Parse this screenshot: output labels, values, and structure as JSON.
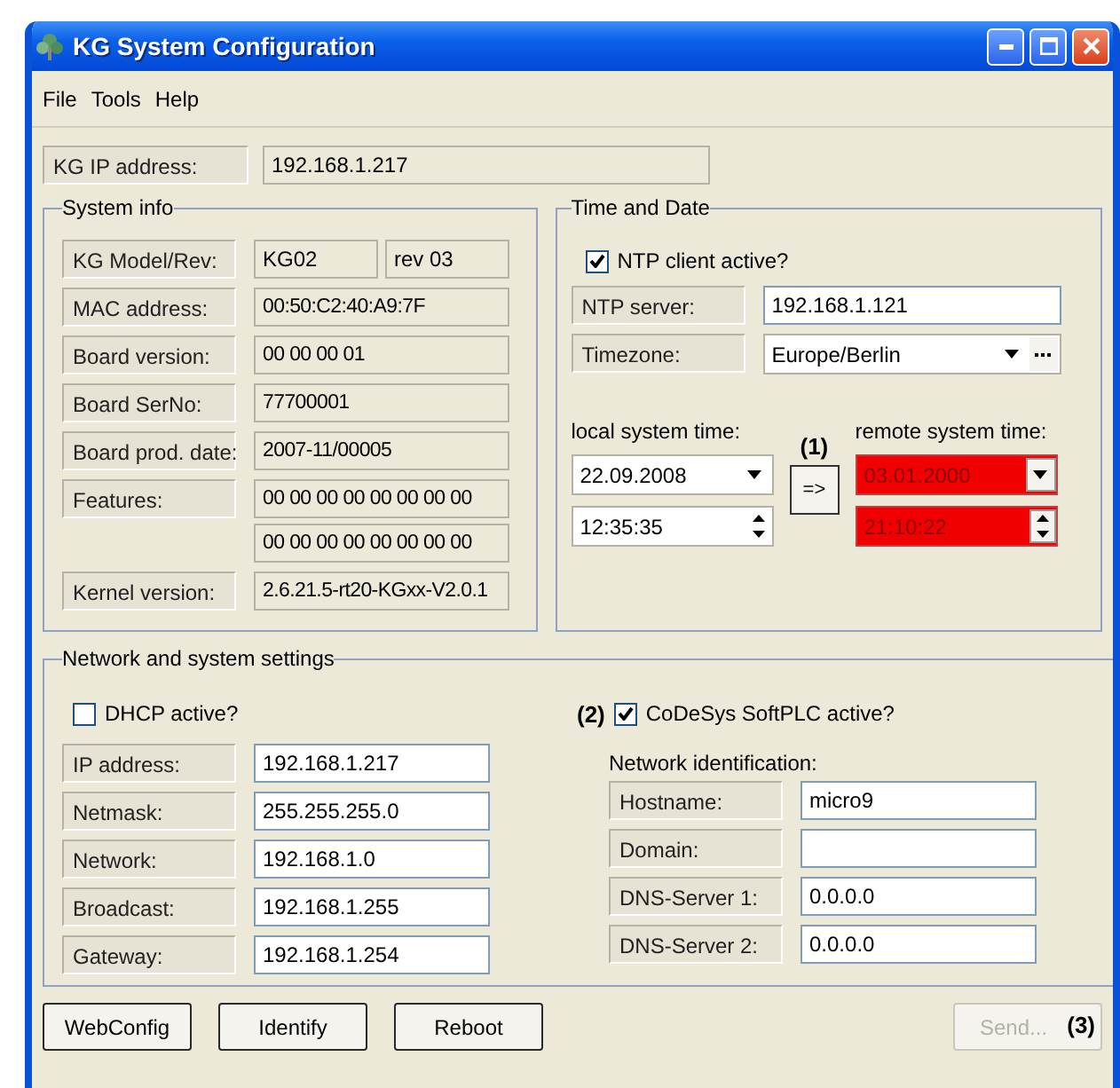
{
  "window": {
    "title": "KG System Configuration"
  },
  "menu": [
    "File",
    "Tools",
    "Help"
  ],
  "kg_ip": {
    "label": "KG IP address:",
    "value": "192.168.1.217"
  },
  "system_info": {
    "title": "System info",
    "rows": [
      {
        "kind": "pair",
        "label": "KG Model/Rev:",
        "values": [
          "KG02",
          "rev 03"
        ]
      },
      {
        "kind": "single",
        "label": "MAC address:",
        "values": [
          "00:50:C2:40:A9:7F"
        ]
      },
      {
        "kind": "single",
        "label": "Board version:",
        "values": [
          "00 00 00 01"
        ]
      },
      {
        "kind": "single",
        "label": "Board SerNo:",
        "values": [
          "77700001"
        ]
      },
      {
        "kind": "single",
        "label": "Board prod. date:",
        "values": [
          "2007-11/00005"
        ]
      },
      {
        "kind": "stack",
        "label": "Features:",
        "values": [
          "00 00 00 00 00 00 00 00",
          "00 00 00 00 00 00 00 00"
        ]
      },
      {
        "kind": "single",
        "label": "Kernel version:",
        "values": [
          "2.6.21.5-rt20-KGxx-V2.0.1"
        ]
      }
    ]
  },
  "time_and_date": {
    "title": "Time and Date",
    "ntp_active": {
      "label": "NTP client active?",
      "checked": true
    },
    "ntp_server": {
      "label": "NTP server:",
      "value": "192.168.1.121"
    },
    "timezone": {
      "label": "Timezone:",
      "value": "Europe/Berlin"
    },
    "local": {
      "label": "local system time:",
      "date": "22.09.2008",
      "time": "12:35:35",
      "error": false
    },
    "sync": {
      "label": "=>",
      "annotation": "(1)"
    },
    "remote": {
      "label": "remote system time:",
      "date": "03.01.2000",
      "time": "21:10:22",
      "error": true
    }
  },
  "network": {
    "title": "Network and system settings",
    "dhcp": {
      "label": "DHCP active?",
      "checked": false
    },
    "fields": [
      {
        "label": "IP address:",
        "value": "192.168.1.217"
      },
      {
        "label": "Netmask:",
        "value": "255.255.255.0"
      },
      {
        "label": "Network:",
        "value": "192.168.1.0"
      },
      {
        "label": "Broadcast:",
        "value": "192.168.1.255"
      },
      {
        "label": "Gateway:",
        "value": "192.168.1.254"
      }
    ],
    "codesys": {
      "annotation": "(2)",
      "label": "CoDeSys SoftPLC active?",
      "checked": true
    },
    "identification": {
      "title": "Network identification:",
      "fields": [
        {
          "label": "Hostname:",
          "value": "micro9"
        },
        {
          "label": "Domain:"
        },
        {
          "label": "DNS-Server 1:",
          "value": "0.0.0.0"
        },
        {
          "label": "DNS-Server 2:",
          "value": "0.0.0.0"
        }
      ]
    }
  },
  "buttons": [
    {
      "label": "WebConfig",
      "disabled": false
    },
    {
      "label": "Identify",
      "disabled": false
    },
    {
      "label": "Reboot",
      "disabled": false
    },
    {
      "label": "Send...",
      "disabled": true,
      "annotation": "(3)"
    }
  ]
}
